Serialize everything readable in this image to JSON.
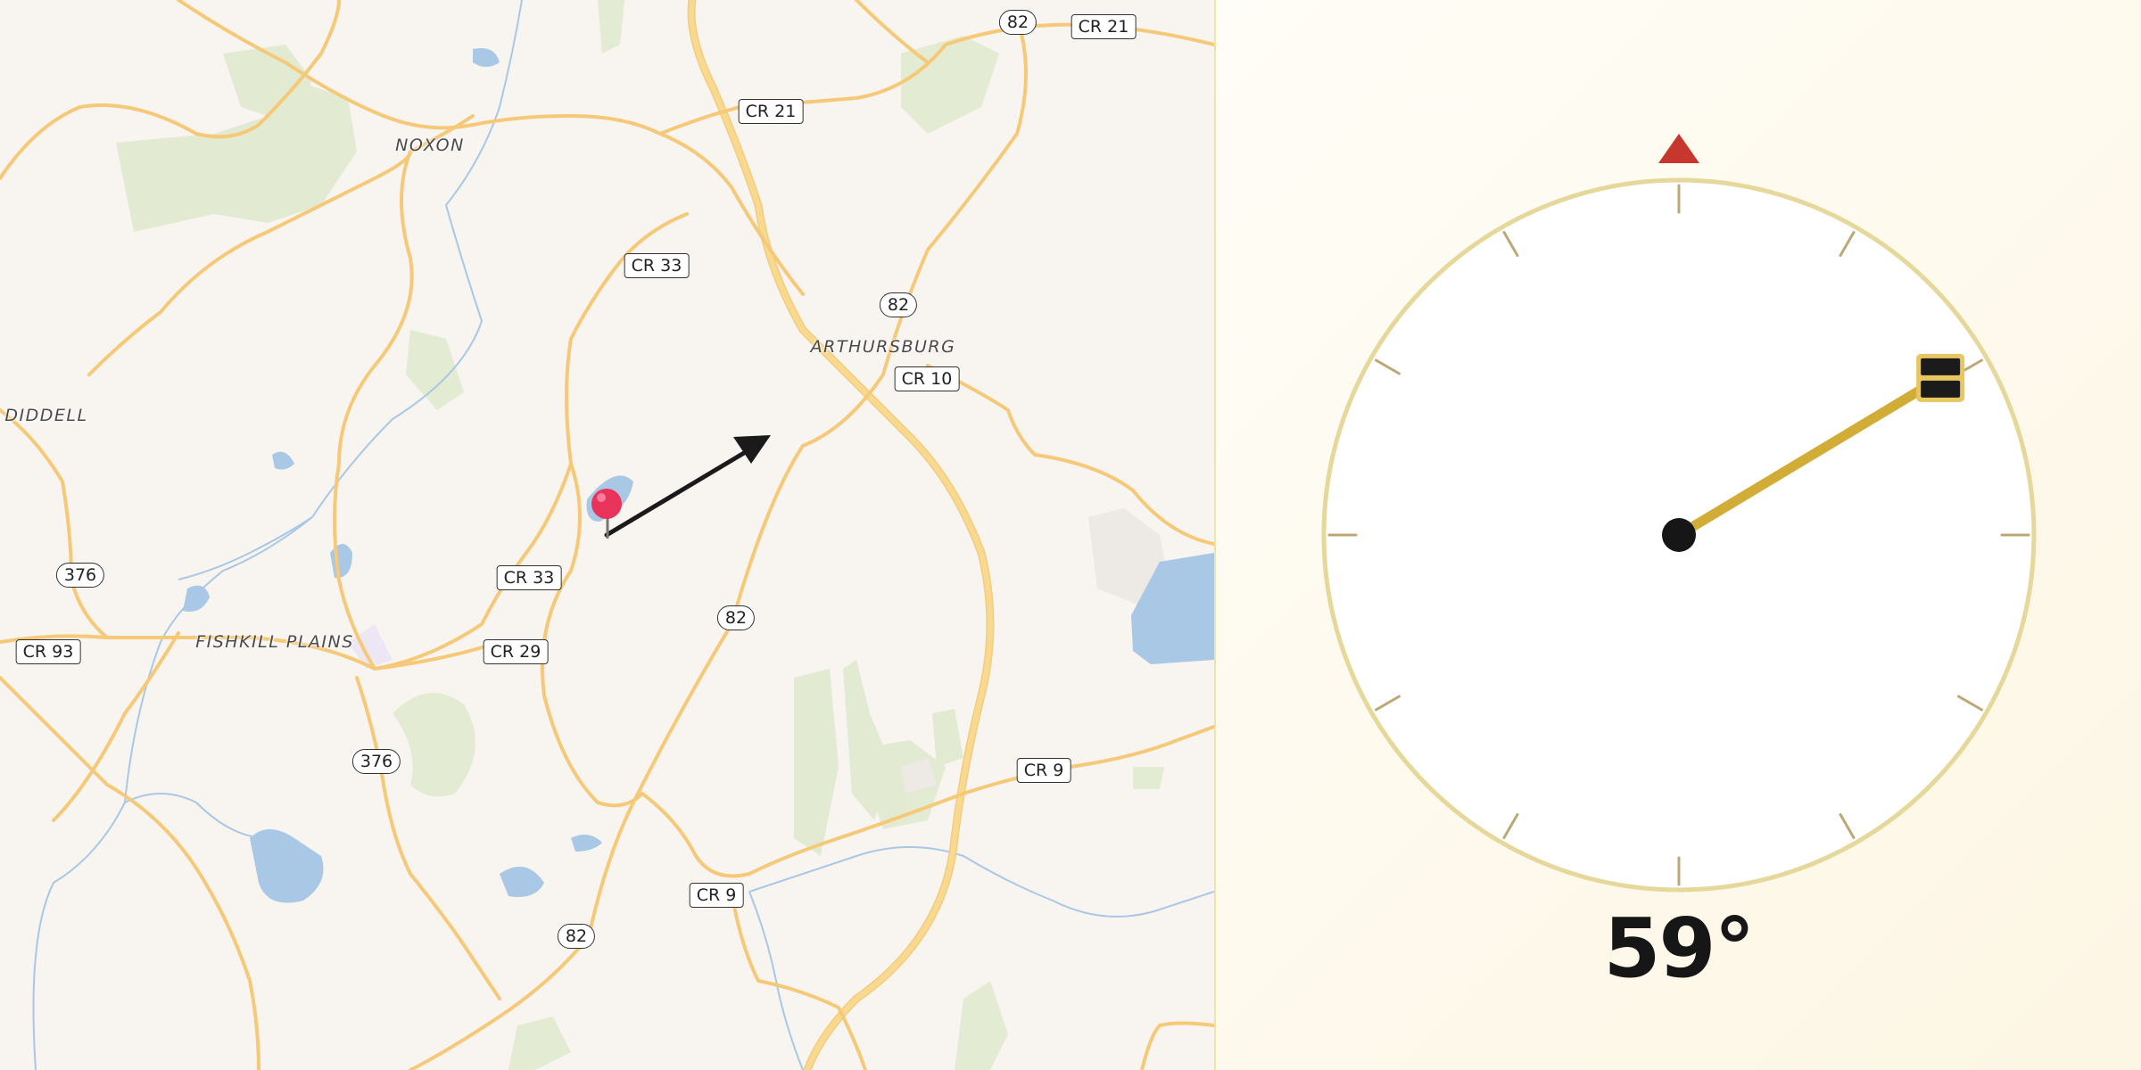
{
  "map": {
    "places": [
      {
        "id": "noxon",
        "label": "NOXON"
      },
      {
        "id": "arthursburg",
        "label": "ARTHURSBURG"
      },
      {
        "id": "diddell",
        "label": "DIDDELL"
      },
      {
        "id": "fishkill-plains",
        "label": "FISHKILL PLAINS"
      }
    ],
    "road_shields": [
      {
        "id": "r82-top",
        "label": "82",
        "shape": "oval"
      },
      {
        "id": "cr21-top",
        "label": "CR 21",
        "shape": "box"
      },
      {
        "id": "cr21-mid",
        "label": "CR 21",
        "shape": "box"
      },
      {
        "id": "cr33-north",
        "label": "CR 33",
        "shape": "box"
      },
      {
        "id": "r82-mid",
        "label": "82",
        "shape": "oval"
      },
      {
        "id": "cr10",
        "label": "CR 10",
        "shape": "box"
      },
      {
        "id": "r376-west",
        "label": "376",
        "shape": "oval"
      },
      {
        "id": "cr33-south",
        "label": "CR 33",
        "shape": "box"
      },
      {
        "id": "r82-south",
        "label": "82",
        "shape": "oval"
      },
      {
        "id": "cr93",
        "label": "CR 93",
        "shape": "box"
      },
      {
        "id": "cr29",
        "label": "CR 29",
        "shape": "box"
      },
      {
        "id": "r376-south",
        "label": "376",
        "shape": "oval"
      },
      {
        "id": "cr9-east",
        "label": "CR 9",
        "shape": "box"
      },
      {
        "id": "cr9-south",
        "label": "CR 9",
        "shape": "box"
      },
      {
        "id": "r82-bottom",
        "label": "82",
        "shape": "oval"
      }
    ],
    "marker": {
      "icon": "map-pin-icon",
      "color": "#e8335a"
    },
    "heading_arrow": {
      "icon": "direction-arrow-icon",
      "color": "#1a1a1a"
    }
  },
  "compass": {
    "heading_deg": 59,
    "readout": "59°",
    "north_marker": {
      "icon": "north-triangle-icon",
      "color": "#c8372d"
    },
    "needle_color": "#d1ad38",
    "ring_color": "#e6d79a",
    "tick_color": "#bda777"
  }
}
